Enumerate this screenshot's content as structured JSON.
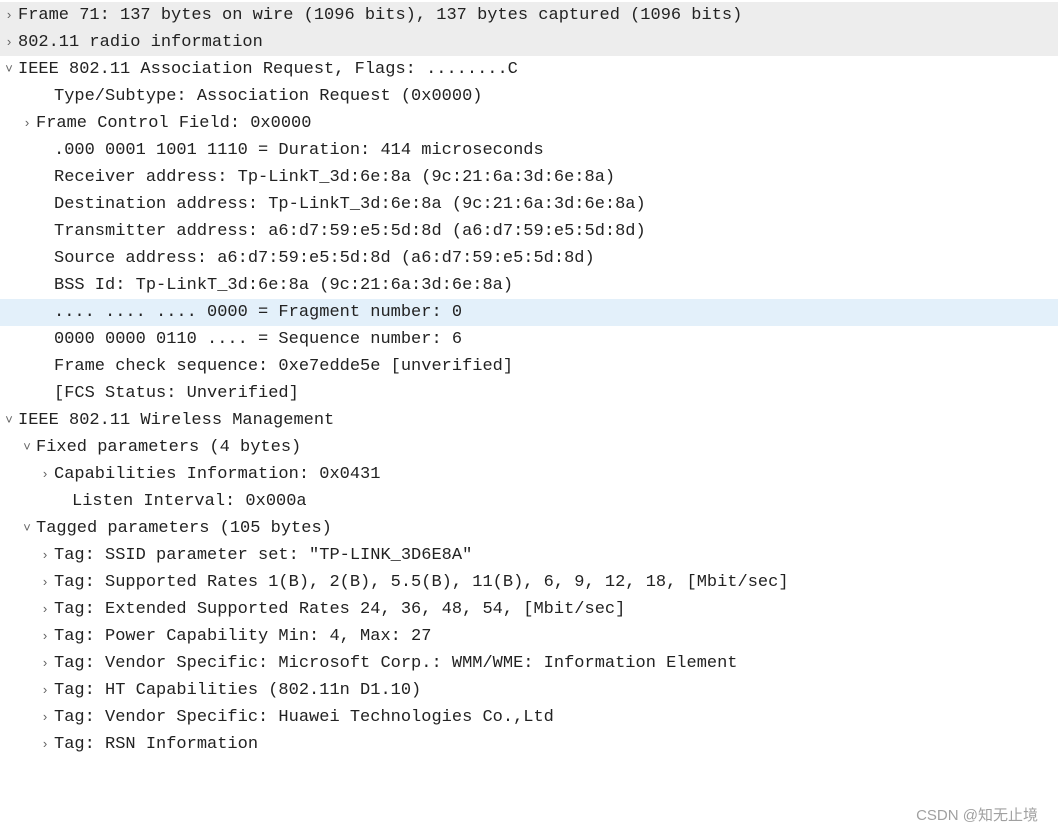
{
  "icons": {
    "right": "›",
    "down": "˅"
  },
  "watermark": "CSDN @知无止境",
  "lines": [
    {
      "cls": "top",
      "g": "right",
      "ind": 0,
      "t": "Frame 71: 137 bytes on wire (1096 bits), 137 bytes captured (1096 bits)"
    },
    {
      "cls": "top",
      "g": "right",
      "ind": 0,
      "t": "802.11 radio information"
    },
    {
      "cls": "",
      "g": "down",
      "ind": 0,
      "t": "IEEE 802.11 Association Request, Flags: ........C"
    },
    {
      "cls": "",
      "g": "",
      "ind": 2,
      "t": "Type/Subtype: Association Request (0x0000)"
    },
    {
      "cls": "",
      "g": "right",
      "ind": 1,
      "t": "Frame Control Field: 0x0000"
    },
    {
      "cls": "",
      "g": "",
      "ind": 2,
      "t": ".000 0001 1001 1110 = Duration: 414 microseconds"
    },
    {
      "cls": "",
      "g": "",
      "ind": 2,
      "t": "Receiver address: Tp-LinkT_3d:6e:8a (9c:21:6a:3d:6e:8a)"
    },
    {
      "cls": "",
      "g": "",
      "ind": 2,
      "t": "Destination address: Tp-LinkT_3d:6e:8a (9c:21:6a:3d:6e:8a)"
    },
    {
      "cls": "",
      "g": "",
      "ind": 2,
      "t": "Transmitter address: a6:d7:59:e5:5d:8d (a6:d7:59:e5:5d:8d)"
    },
    {
      "cls": "",
      "g": "",
      "ind": 2,
      "t": "Source address: a6:d7:59:e5:5d:8d (a6:d7:59:e5:5d:8d)"
    },
    {
      "cls": "",
      "g": "",
      "ind": 2,
      "t": "BSS Id: Tp-LinkT_3d:6e:8a (9c:21:6a:3d:6e:8a)"
    },
    {
      "cls": "sel",
      "g": "",
      "ind": 2,
      "t": ".... .... .... 0000 = Fragment number: 0"
    },
    {
      "cls": "",
      "g": "",
      "ind": 2,
      "t": "0000 0000 0110 .... = Sequence number: 6"
    },
    {
      "cls": "",
      "g": "",
      "ind": 2,
      "t": "Frame check sequence: 0xe7edde5e [unverified]"
    },
    {
      "cls": "",
      "g": "",
      "ind": 2,
      "t": "[FCS Status: Unverified]"
    },
    {
      "cls": "",
      "g": "down",
      "ind": 0,
      "t": "IEEE 802.11 Wireless Management"
    },
    {
      "cls": "",
      "g": "down",
      "ind": 1,
      "t": "Fixed parameters (4 bytes)"
    },
    {
      "cls": "",
      "g": "right",
      "ind": 2,
      "t": "Capabilities Information: 0x0431"
    },
    {
      "cls": "",
      "g": "",
      "ind": 3,
      "t": "Listen Interval: 0x000a"
    },
    {
      "cls": "",
      "g": "down",
      "ind": 1,
      "t": "Tagged parameters (105 bytes)"
    },
    {
      "cls": "",
      "g": "right",
      "ind": 2,
      "t": "Tag: SSID parameter set: \"TP-LINK_3D6E8A\""
    },
    {
      "cls": "",
      "g": "right",
      "ind": 2,
      "t": "Tag: Supported Rates 1(B), 2(B), 5.5(B), 11(B), 6, 9, 12, 18, [Mbit/sec]"
    },
    {
      "cls": "",
      "g": "right",
      "ind": 2,
      "t": "Tag: Extended Supported Rates 24, 36, 48, 54, [Mbit/sec]"
    },
    {
      "cls": "",
      "g": "right",
      "ind": 2,
      "t": "Tag: Power Capability Min: 4, Max: 27"
    },
    {
      "cls": "",
      "g": "right",
      "ind": 2,
      "t": "Tag: Vendor Specific: Microsoft Corp.: WMM/WME: Information Element"
    },
    {
      "cls": "",
      "g": "right",
      "ind": 2,
      "t": "Tag: HT Capabilities (802.11n D1.10)"
    },
    {
      "cls": "",
      "g": "right",
      "ind": 2,
      "t": "Tag: Vendor Specific: Huawei Technologies Co.,Ltd"
    },
    {
      "cls": "",
      "g": "right",
      "ind": 2,
      "t": "Tag: RSN Information"
    }
  ]
}
